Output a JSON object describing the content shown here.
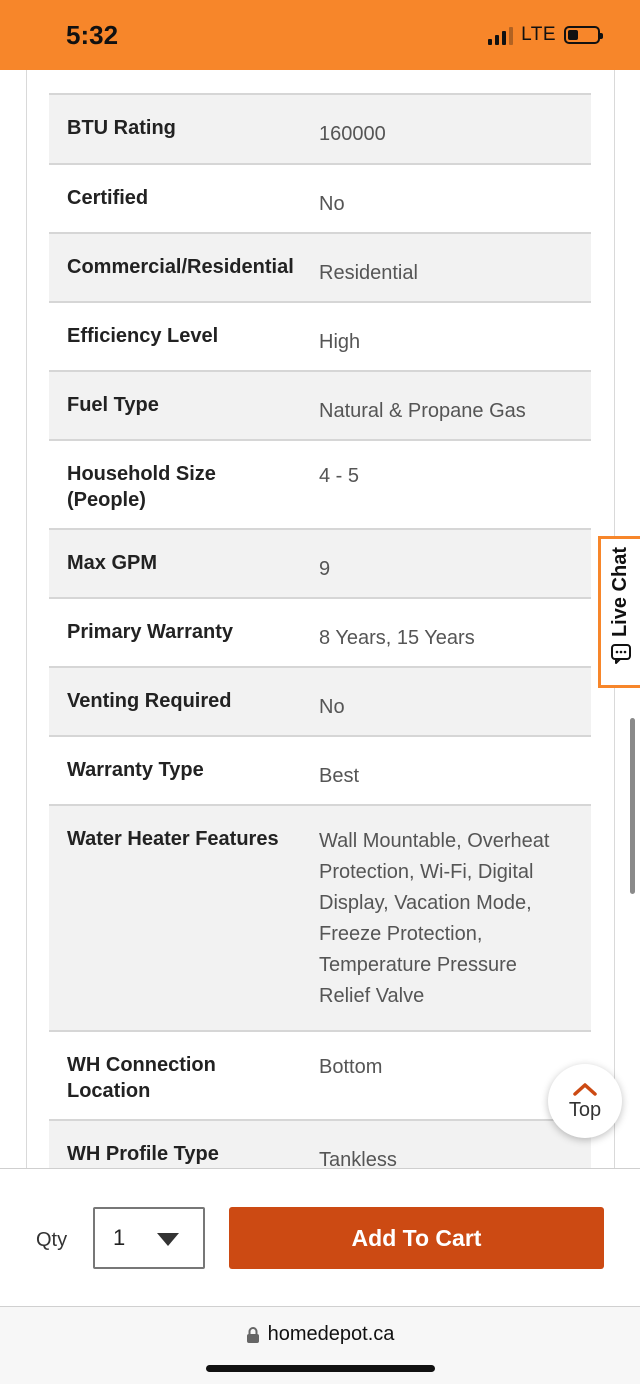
{
  "status_bar": {
    "time": "5:32",
    "network": "LTE",
    "icons": [
      "signal-icon",
      "battery-icon"
    ]
  },
  "specs": [
    {
      "label": "BTU Rating",
      "value": "160000"
    },
    {
      "label": "Certified",
      "value": "No"
    },
    {
      "label": "Commercial/Residential",
      "value": "Residential"
    },
    {
      "label": "Efficiency Level",
      "value": "High"
    },
    {
      "label": "Fuel Type",
      "value": "Natural & Propane Gas"
    },
    {
      "label": "Household Size (People)",
      "value": "4 - 5"
    },
    {
      "label": "Max GPM",
      "value": "9"
    },
    {
      "label": "Primary Warranty",
      "value": "8 Years, 15 Years"
    },
    {
      "label": "Venting Required",
      "value": "No"
    },
    {
      "label": "Warranty Type",
      "value": "Best"
    },
    {
      "label": "Water Heater Features",
      "value": "Wall Mountable, Overheat Protection, Wi-Fi, Digital Display, Vacation Mode, Freeze Protection, Temperature Pressure Relief Valve"
    },
    {
      "label": "WH Connection Location",
      "value": "Bottom"
    },
    {
      "label": "WH Profile Type",
      "value": "Tankless"
    }
  ],
  "live_chat": {
    "label": "Live Chat",
    "icon": "chat-bubble-icon"
  },
  "top_button": {
    "label": "Top",
    "icon": "chevron-up-icon"
  },
  "cart_bar": {
    "qty_label": "Qty",
    "qty_value": "1",
    "add_to_cart_label": "Add To Cart"
  },
  "url_bar": {
    "url": "homedepot.ca",
    "icon": "lock-icon"
  },
  "colors": {
    "brand_orange": "#f7862a",
    "cart_button": "#cc4a13"
  }
}
